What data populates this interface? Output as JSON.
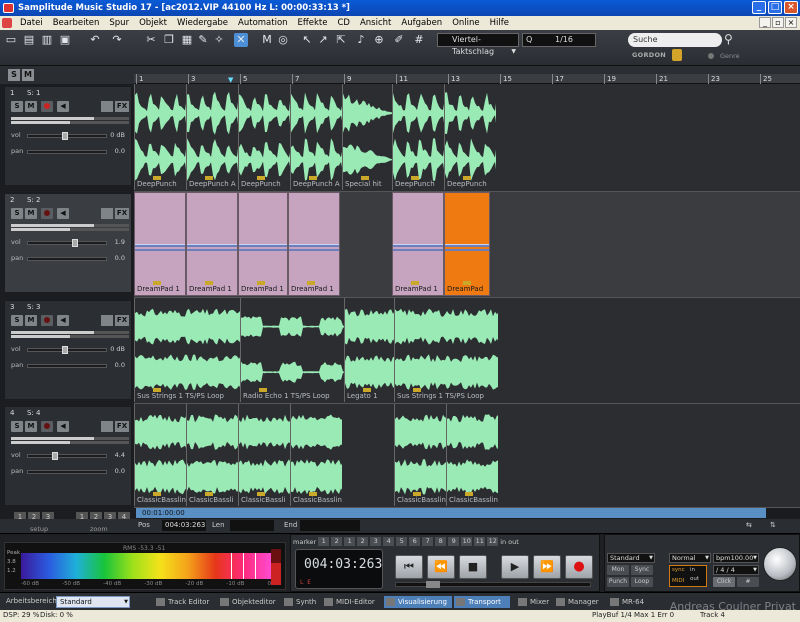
{
  "window": {
    "title": "Samplitude Music Studio 17 - [ac2012.VIP   44100 Hz L: 00:00:33:13 *]"
  },
  "menu": [
    "Datei",
    "Bearbeiten",
    "Spur",
    "Objekt",
    "Wiedergabe",
    "Automation",
    "Effekte",
    "CD",
    "Ansicht",
    "Aufgaben",
    "Online",
    "Hilfe"
  ],
  "toolbar": {
    "grid": "Viertel-Taktschlag",
    "quantize_prefix": "Q",
    "quantize": "1/16",
    "search_placeholder": "Suche",
    "gordon_logo": "GORDON",
    "genre": "Genre"
  },
  "ruler": {
    "ticks": [
      "1",
      "3",
      "5",
      "7",
      "9",
      "11",
      "13",
      "15",
      "17",
      "19",
      "21",
      "23",
      "25"
    ]
  },
  "tracks": [
    {
      "num": "1",
      "name": "S: 1",
      "vol_label": "vol",
      "pan_label": "pan",
      "vol": "0 dB",
      "pan": "0.0"
    },
    {
      "num": "2",
      "name": "S: 2",
      "vol_label": "vol",
      "pan_label": "pan",
      "vol": "1.9",
      "pan": "0.0"
    },
    {
      "num": "3",
      "name": "S: 3",
      "vol_label": "vol",
      "pan_label": "pan",
      "vol": "0 dB",
      "pan": "0.0"
    },
    {
      "num": "4",
      "name": "S: 4",
      "vol_label": "vol",
      "pan_label": "pan",
      "vol": "4.4",
      "pan": "0.0"
    }
  ],
  "clips": {
    "track1": [
      "DeepPunch",
      "DeepPunch A",
      "DeepPunch",
      "DeepPunch A",
      "Special hit",
      "DeepPunch",
      "DeepPunch"
    ],
    "track2": [
      "DreamPad 1",
      "DreamPad 1",
      "DreamPad 1",
      "DreamPad 1",
      "DreamPad 1",
      "DreamPad"
    ],
    "track3": [
      "Sus Strings 1  TS/PS  Loop",
      "Radio Echo 1  TS/PS  Loop",
      "Legato 1",
      "Sus Strings 1  TS/PS  Loop"
    ],
    "track4": [
      "ClassicBasslin",
      "ClassicBassli",
      "ClassicBassli",
      "ClassicBasslin",
      "ClassicBasslin",
      "ClassicBasslin"
    ]
  },
  "position": {
    "time": "00:01:00:00",
    "pos_label": "Pos",
    "pos": "004:03:263",
    "len_label": "Len",
    "end_label": "End",
    "setup": "setup",
    "zoom": "zoom",
    "zoom_buttons": [
      "1",
      "2",
      "3",
      "4"
    ]
  },
  "meter": {
    "peak_label": "Peak",
    "side_values": [
      "3.8",
      "1.2"
    ],
    "rms_label": "RMS  -53.3  -51",
    "scale": [
      "-60 dB",
      "-50 dB",
      "-40 dB",
      "-30 dB",
      "-20 dB",
      "-10 dB",
      "0"
    ],
    "rms_right": "Rms"
  },
  "transport": {
    "marker_label": "marker",
    "in_label": "in",
    "out_label": "out",
    "markers": [
      "1",
      "2",
      "1",
      "2",
      "3",
      "4",
      "5",
      "6",
      "7",
      "8",
      "9",
      "10",
      "11",
      "12"
    ],
    "time": "004:03:263",
    "lr": "L         E",
    "buttons": [
      "⏮",
      "⏪",
      "■",
      "▶",
      "⏩",
      "●"
    ]
  },
  "right_panel": {
    "mode": "Standard",
    "mon": "Mon",
    "sync": "Sync",
    "punch": "Punch",
    "loop": "Loop",
    "normal": "Normal",
    "bpm": "bpm100.00",
    "signature": "/    4 / 4",
    "click": "Click",
    "hash": "#",
    "sync_box": [
      "sync",
      "in",
      "out",
      "MIDI"
    ]
  },
  "status": {
    "workspace_label": "Arbeitsbereich",
    "workspace": "Standard",
    "tabs": [
      "Track Editor",
      "Objekteditor",
      "Synth",
      "MIDI-Editor",
      "Visualisierung",
      "Transport",
      "Mixer",
      "Manager",
      "MR-64"
    ],
    "active_tabs": [
      "Visualisierung",
      "Transport"
    ],
    "watermark": "Andreas Coulner Privat"
  },
  "info": {
    "dsp": "DSP: 29 %",
    "disk": "Disk:   0 %",
    "playbuf": "PlayBuf 1/4  Max 1  Err 0",
    "track": "Track 4"
  },
  "colors": {
    "wave": "#9aeab5",
    "pad": "#c6a4c0",
    "pad_selected": "#ef7a12",
    "accent": "#4d8fd6"
  }
}
